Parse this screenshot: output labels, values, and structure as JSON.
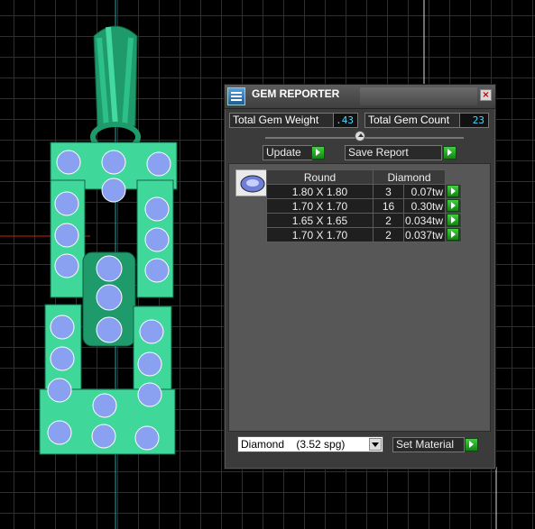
{
  "panel": {
    "title": "GEM REPORTER",
    "close_icon": "close-icon",
    "total_gem_weight_label": "Total Gem Weight",
    "total_gem_weight_value": ".43",
    "total_gem_count_label": "Total Gem Count",
    "total_gem_count_value": "23",
    "update_label": "Update",
    "save_report_label": "Save Report",
    "table": {
      "header_shape": "Round",
      "header_material": "Diamond",
      "rows": [
        {
          "size": "1.80 X 1.80",
          "count": "3",
          "carat": "0.07tw"
        },
        {
          "size": "1.70 X 1.70",
          "count": "16",
          "carat": "0.30tw"
        },
        {
          "size": "1.65 X 1.65",
          "count": "2",
          "carat": "0.034tw"
        },
        {
          "size": "1.70 X 1.70",
          "count": "2",
          "carat": "0.037tw"
        }
      ]
    },
    "material_select_value": "Diamond    (3.52 spg)",
    "set_material_label": "Set Material"
  },
  "colors": {
    "accent_value": "#4fd8ff",
    "go_button": "#22a822",
    "metal": "#2fbf85",
    "gem": "#8090e0"
  }
}
